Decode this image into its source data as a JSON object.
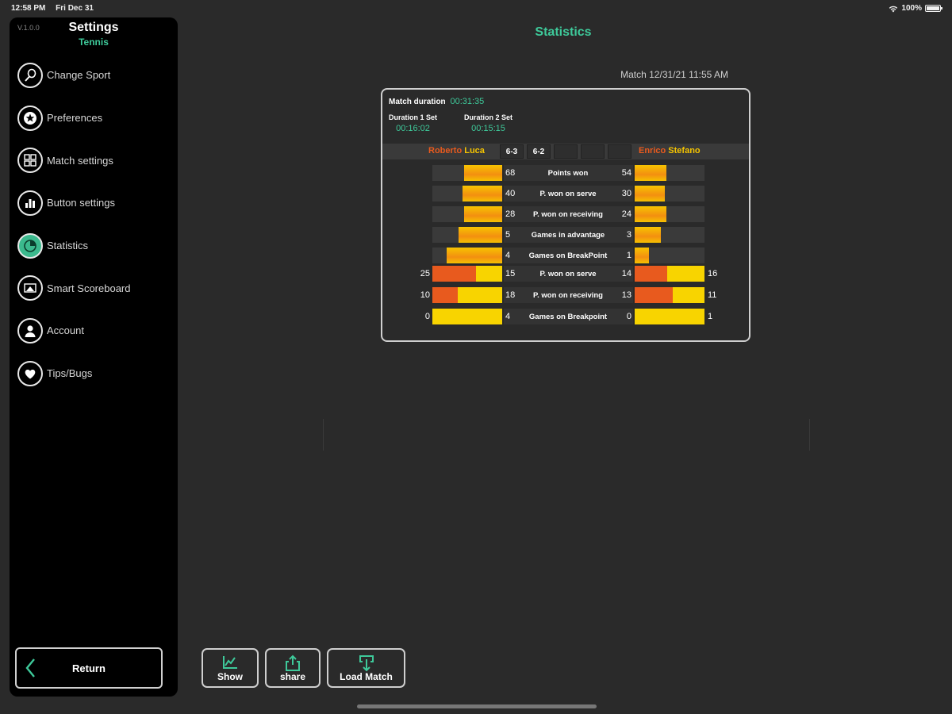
{
  "status_bar": {
    "time": "12:58 PM",
    "date": "Fri Dec 31",
    "battery": "100%"
  },
  "sidebar": {
    "version": "V.1.0.0",
    "title": "Settings",
    "subtitle": "Tennis",
    "items": [
      {
        "label": "Change Sport",
        "icon": "racket-icon"
      },
      {
        "label": "Preferences",
        "icon": "star-icon"
      },
      {
        "label": "Match settings",
        "icon": "puzzle-icon"
      },
      {
        "label": "Button settings",
        "icon": "buttons-icon"
      },
      {
        "label": "Statistics",
        "icon": "pie-chart-icon",
        "active": true
      },
      {
        "label": "Smart Scoreboard",
        "icon": "scoreboard-icon"
      },
      {
        "label": "Account",
        "icon": "user-icon"
      },
      {
        "label": "Tips/Bugs",
        "icon": "heart-icon"
      }
    ],
    "return_label": "Return"
  },
  "main": {
    "title": "Statistics",
    "match_date": "Match 12/31/21 11:55 AM",
    "match_duration_label": "Match duration",
    "match_duration": "00:31:35",
    "set1_label": "Duration 1 Set",
    "set1_duration": "00:16:02",
    "set2_label": "Duration 2 Set",
    "set2_duration": "00:15:15",
    "player1": {
      "first": "Roberto",
      "last": "Luca"
    },
    "player2": {
      "first": "Enrico",
      "last": "Stefano"
    },
    "set_scores": [
      "6-3",
      "6-2",
      "",
      "",
      ""
    ],
    "colors": {
      "accent": "#3ec99a",
      "orange": "#e85a1e",
      "yellow": "#f5c400"
    },
    "stats": [
      {
        "label": "Points won",
        "left": "68",
        "right": "54",
        "left_bar": 0.55,
        "right_bar": 0.45
      },
      {
        "label": "P. won on serve",
        "left": "40",
        "right": "30",
        "left_bar": 0.57,
        "right_bar": 0.43
      },
      {
        "label": "P. won on receiving",
        "left": "28",
        "right": "24",
        "left_bar": 0.54,
        "right_bar": 0.46
      },
      {
        "label": "Games in advantage",
        "left": "5",
        "right": "3",
        "left_bar": 0.63,
        "right_bar": 0.37
      },
      {
        "label": "Games on BreakPoint",
        "left": "4",
        "right": "1",
        "left_bar": 0.8,
        "right_bar": 0.2
      },
      {
        "label": "P. won on serve",
        "left": "15",
        "right": "14",
        "left_outer": "25",
        "right_outer": "16",
        "left_split": 0.63,
        "right_split": 0.47
      },
      {
        "label": "P. won on receiving",
        "left": "18",
        "right": "13",
        "left_outer": "10",
        "right_outer": "11",
        "left_split": 0.36,
        "right_split": 0.54
      },
      {
        "label": "Games on Breakpoint",
        "left": "4",
        "right": "0",
        "left_outer": "0",
        "right_outer": "1",
        "left_split": 0.0,
        "right_split": 0.0
      }
    ]
  },
  "buttons": {
    "show": "Show",
    "share": "share",
    "load": "Load Match"
  }
}
